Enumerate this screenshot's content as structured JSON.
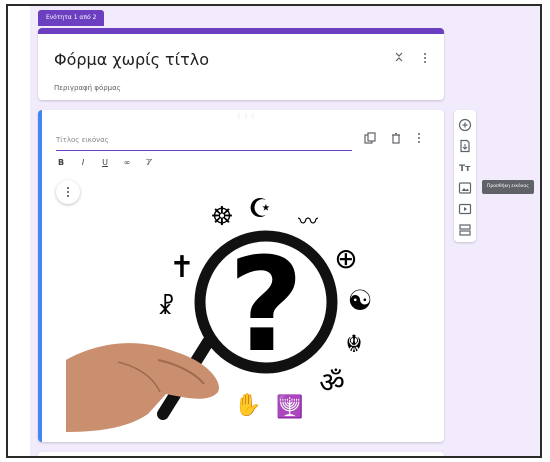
{
  "section": {
    "label": "Ενότητα 1 από 2"
  },
  "form": {
    "title": "Φόρμα χωρίς τίτλο",
    "description": "Περιγραφή φόρμας"
  },
  "image_item": {
    "title_placeholder": "Τίτλος εικόνας",
    "format_buttons": [
      "B",
      "I",
      "U",
      "∞",
      "⊤̸"
    ]
  },
  "sidebar": {
    "tooltip": "Προσθήκη εικόνας",
    "icons": [
      "add-question-icon",
      "import-questions-icon",
      "add-title-icon",
      "add-image-icon",
      "add-video-icon",
      "add-section-icon"
    ]
  },
  "image": {
    "glyphs": {
      "question": "?",
      "cross": "✝",
      "crescent": "☪",
      "wheel": "☸",
      "yin_yang": "☯",
      "khanda": "☬",
      "om": "ॐ",
      "menorah": "🕎",
      "hamsa": "✋",
      "farohar": "〰",
      "circle_cross": "⊕",
      "chi_rho": "☧"
    }
  },
  "colors": {
    "accent": "#6b3fc0",
    "active_bar": "#4285f4",
    "background": "#f1ebfb"
  }
}
